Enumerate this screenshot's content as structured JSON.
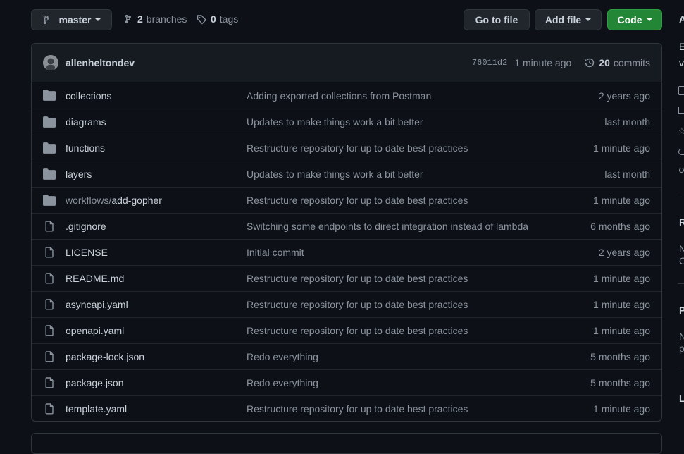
{
  "branch": {
    "label": "master"
  },
  "branches": {
    "count": "2",
    "label": "branches"
  },
  "tags": {
    "count": "0",
    "label": "tags"
  },
  "actions": {
    "go_to_file": "Go to file",
    "add_file": "Add file",
    "code": "Code"
  },
  "colors": {
    "code_button": "#238636",
    "background": "#0d1117",
    "header": "#161b22"
  },
  "latest_commit": {
    "author": "allenheltondev",
    "sha": "76011d2",
    "time": "1 minute ago",
    "commits_count": "20",
    "commits_label": "commits"
  },
  "files": [
    {
      "type": "dir",
      "name": "collections",
      "message": "Adding exported collections from Postman",
      "age": "2 years ago"
    },
    {
      "type": "dir",
      "name": "diagrams",
      "message": "Updates to make things work a bit better",
      "age": "last month"
    },
    {
      "type": "dir",
      "name": "functions",
      "message": "Restructure repository for up to date best practices",
      "age": "1 minute ago"
    },
    {
      "type": "dir",
      "name": "layers",
      "message": "Updates to make things work a bit better",
      "age": "last month"
    },
    {
      "type": "dir",
      "name_prefix": "workflows/",
      "name": "add-gopher",
      "message": "Restructure repository for up to date best practices",
      "age": "1 minute ago"
    },
    {
      "type": "file",
      "name": ".gitignore",
      "message": "Switching some endpoints to direct integration instead of lambda",
      "age": "6 months ago"
    },
    {
      "type": "file",
      "name": "LICENSE",
      "message": "Initial commit",
      "age": "2 years ago"
    },
    {
      "type": "file",
      "name": "README.md",
      "message": "Restructure repository for up to date best practices",
      "age": "1 minute ago"
    },
    {
      "type": "file",
      "name": "asyncapi.yaml",
      "message": "Restructure repository for up to date best practices",
      "age": "1 minute ago"
    },
    {
      "type": "file",
      "name": "openapi.yaml",
      "message": "Restructure repository for up to date best practices",
      "age": "1 minute ago"
    },
    {
      "type": "file",
      "name": "package-lock.json",
      "message": "Redo everything",
      "age": "5 months ago"
    },
    {
      "type": "file",
      "name": "package.json",
      "message": "Redo everything",
      "age": "5 months ago"
    },
    {
      "type": "file",
      "name": "template.yaml",
      "message": "Restructure repository for up to date best practices",
      "age": "1 minute ago"
    }
  ],
  "sidebar_edge": {
    "a": "A",
    "e": "E",
    "v": "v",
    "r": "R",
    "n1": "N",
    "c": "C",
    "p": "P",
    "n2": "N",
    "p2": "p",
    "l": "L"
  }
}
